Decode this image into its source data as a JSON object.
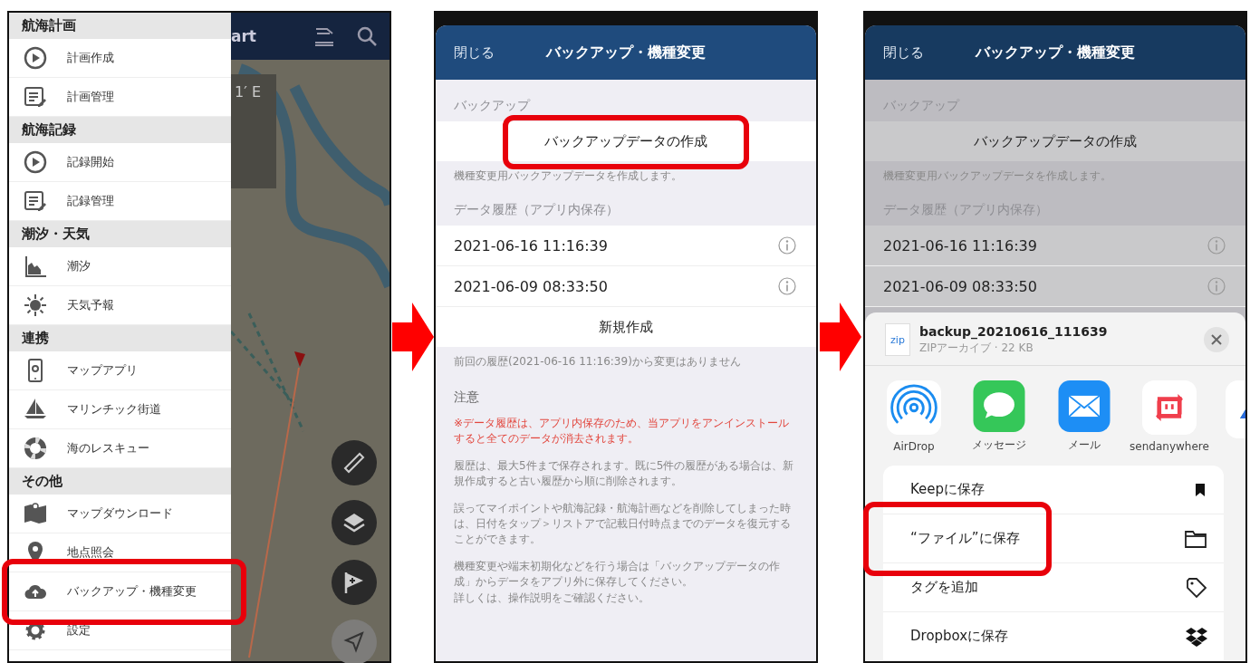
{
  "panels": [
    {
      "kind": "menu",
      "map_title": "art",
      "coordinate": "1′ E",
      "menu": [
        {
          "kind": "section",
          "label": "航海計画"
        },
        {
          "kind": "item",
          "label": "計画作成",
          "highlighted": false
        },
        {
          "kind": "item",
          "label": "計画管理",
          "highlighted": false
        },
        {
          "kind": "section",
          "label": "航海記録"
        },
        {
          "kind": "item",
          "label": "記録開始",
          "highlighted": false
        },
        {
          "kind": "item",
          "label": "記録管理",
          "highlighted": false
        },
        {
          "kind": "section",
          "label": "潮汐・天気"
        },
        {
          "kind": "item",
          "label": "潮汐",
          "highlighted": false
        },
        {
          "kind": "item",
          "label": "天気予報",
          "highlighted": false
        },
        {
          "kind": "section",
          "label": "連携"
        },
        {
          "kind": "item",
          "label": "マップアプリ",
          "highlighted": false
        },
        {
          "kind": "item",
          "label": "マリンチック街道",
          "highlighted": false
        },
        {
          "kind": "item",
          "label": "海のレスキュー",
          "highlighted": false
        },
        {
          "kind": "section",
          "label": "その他"
        },
        {
          "kind": "item",
          "label": "マップダウンロード",
          "highlighted": false
        },
        {
          "kind": "item",
          "label": "地点照会",
          "highlighted": false
        },
        {
          "kind": "item",
          "label": "バックアップ・機種変更",
          "highlighted": true
        },
        {
          "kind": "item",
          "label": "設定",
          "highlighted": false
        }
      ]
    },
    {
      "kind": "settings",
      "dimmed": false,
      "close": "閉じる",
      "title": "バックアップ・機種変更",
      "backup_heading": "バックアップ",
      "create_button": {
        "label": "バックアップデータの作成",
        "highlighted": true
      },
      "create_note": "機種変更用バックアップデータを作成します。",
      "history_heading": "データ履歴（アプリ内保存）",
      "history": [
        {
          "date": "2021-06-16 11:16:39"
        },
        {
          "date": "2021-06-09 08:33:50"
        }
      ],
      "new_button": "新規作成",
      "status_note": "前回の履歴(2021-06-16 11:16:39)から変更はありません",
      "caution_heading": "注意",
      "warning": "※データ履歴は、アプリ内保存のため、当アプリをアンインストールすると全てのデータが消去されます。",
      "paragraphs": [
        [
          "履歴は、最大5件まで保存されます。既に5件の履歴がある場合は、新規作成すると古い履歴から順に削除されます。"
        ],
        [
          "誤ってマイポイントや航海記録・航海計画などを削除してしまった時は、日付をタップ＞リストアで記載日付時点までのデータを復元することができます。"
        ],
        [
          "機種変更や端末初期化などを行う場合は「バックアップデータの作成」からデータをアプリ外に保存してください。",
          "詳しくは、操作説明をご確認ください。"
        ]
      ]
    },
    {
      "kind": "settings",
      "dimmed": true,
      "close": "閉じる",
      "title": "バックアップ・機種変更",
      "backup_heading": "バックアップ",
      "create_button": {
        "label": "バックアップデータの作成",
        "highlighted": false
      },
      "create_note": "機種変更用バックアップデータを作成します。",
      "history_heading": "データ履歴（アプリ内保存）",
      "history": [
        {
          "date": "2021-06-16 11:16:39"
        },
        {
          "date": "2021-06-09 08:33:50"
        }
      ],
      "share_sheet": {
        "file_type": "zip",
        "file_name": "backup_20210616_111639",
        "file_info": "ZIPアーカイブ · 22 KB",
        "apps": [
          {
            "label": "AirDrop"
          },
          {
            "label": "メッセージ"
          },
          {
            "label": "メール"
          },
          {
            "label": "sendanywhere"
          }
        ],
        "actions": [
          {
            "label": "Keepに保存",
            "highlighted": false
          },
          {
            "label": "“ファイル”に保存",
            "highlighted": true
          },
          {
            "label": "タグを追加",
            "highlighted": false
          },
          {
            "label": "Dropboxに保存",
            "highlighted": false
          }
        ]
      }
    }
  ]
}
